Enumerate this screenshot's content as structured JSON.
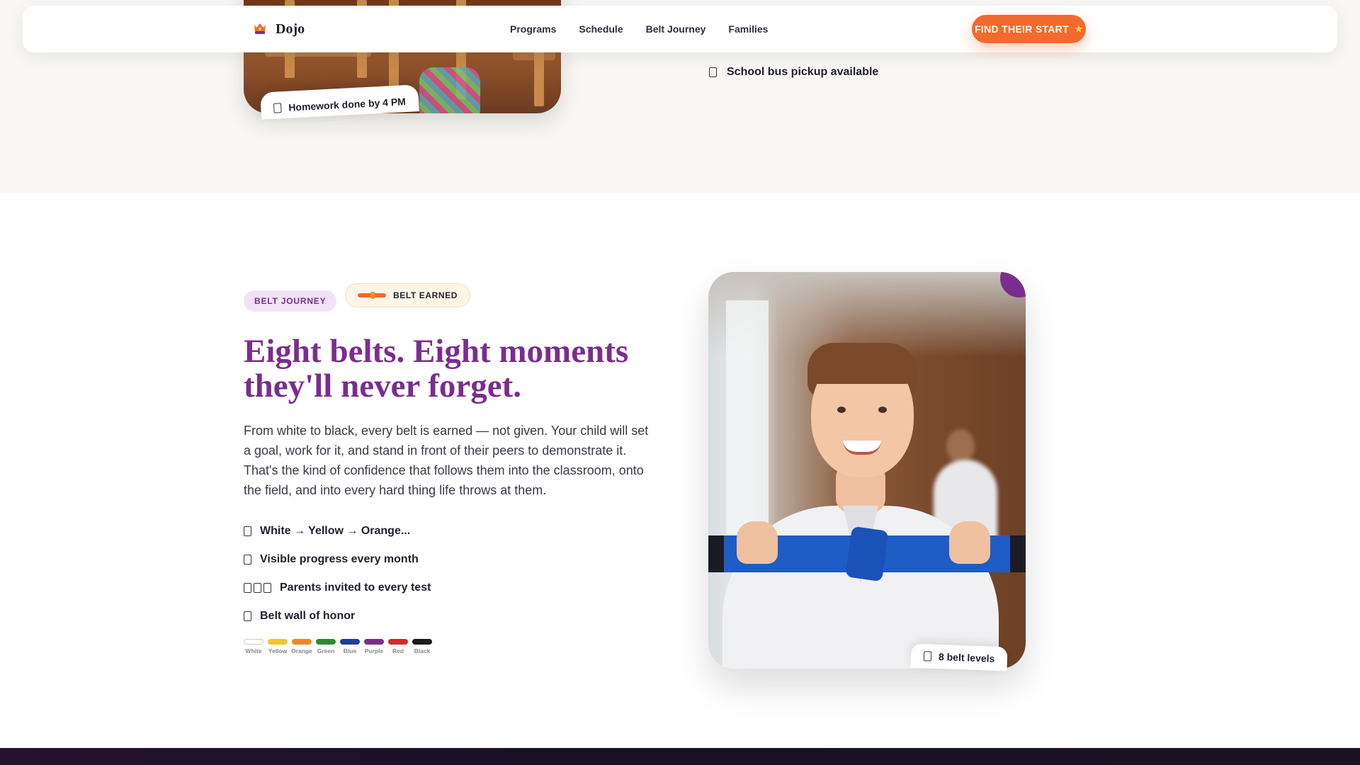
{
  "header": {
    "brand": "Dojo",
    "nav": [
      "Programs",
      "Schedule",
      "Belt Journey",
      "Families"
    ],
    "cta_label": "FIND THEIR START",
    "cta_icon": "star-icon"
  },
  "top_section": {
    "homework_chip": "Homework done by 4 PM",
    "bus_item": "School bus pickup available"
  },
  "belt_section": {
    "eyebrow": "BELT JOURNEY",
    "earned_badge": "BELT EARNED",
    "headline": "Eight belts. Eight moments they'll never forget.",
    "body": "From white to black, every belt is earned — not given. Your child will set a goal, work for it, and stand in front of their peers to demonstrate it. That's the kind of confidence that follows them into the classroom, onto the field, and into every hard thing life throws at them.",
    "features": [
      {
        "text": "White → Yellow → Orange...",
        "icon_count": 1
      },
      {
        "text": "Visible progress every month",
        "icon_count": 1
      },
      {
        "text": "Parents invited to every test",
        "icon_count": 3
      },
      {
        "text": "Belt wall of honor",
        "icon_count": 1
      }
    ],
    "belts": [
      {
        "name": "White",
        "color": "#ffffff"
      },
      {
        "name": "Yellow",
        "color": "#f5c528"
      },
      {
        "name": "Orange",
        "color": "#f08a1e"
      },
      {
        "name": "Green",
        "color": "#2e8b2e"
      },
      {
        "name": "Blue",
        "color": "#1f3f9c"
      },
      {
        "name": "Purple",
        "color": "#7b2d8e"
      },
      {
        "name": "Red",
        "color": "#d62a2a"
      },
      {
        "name": "Black",
        "color": "#1a1a1a"
      }
    ],
    "photo_chip": "8 belt levels"
  },
  "colors": {
    "accent_orange": "#f36a2d",
    "brand_purple": "#7b2d8e"
  }
}
